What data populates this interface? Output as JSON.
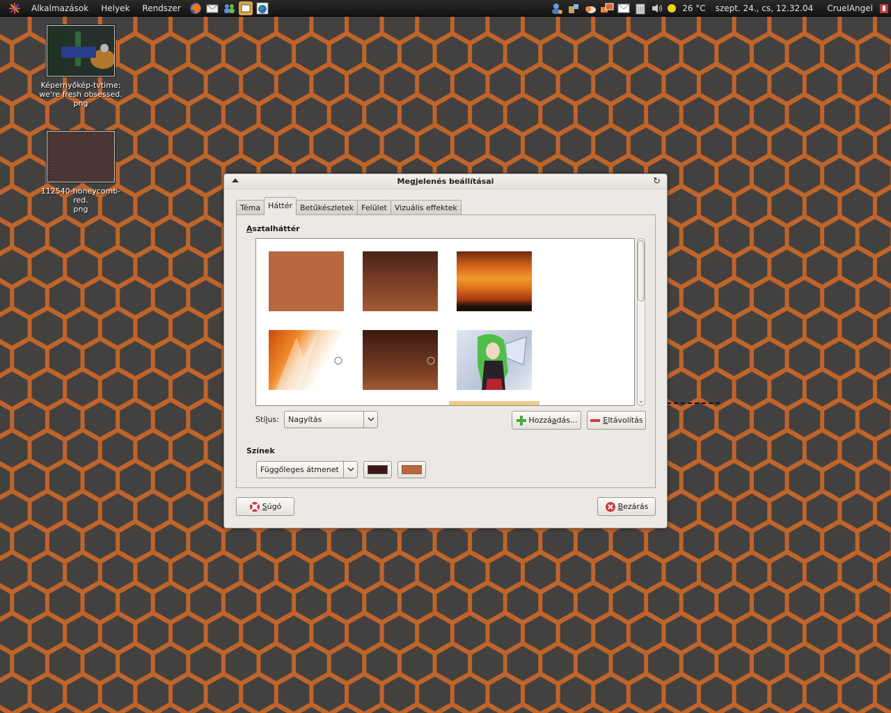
{
  "panel": {
    "menus": [
      "Alkalmazások",
      "Helyek",
      "Rendszer"
    ],
    "launchers": [
      "firefox-icon",
      "mail-icon",
      "contacts-icon",
      "show-desktop-icon",
      "network-globe-icon"
    ],
    "tray_icons": [
      "user-icon",
      "network-icon",
      "update-icon",
      "display-icon",
      "mail-notify-icon",
      "trash-icon",
      "volume-icon"
    ],
    "temperature": "26 °C",
    "clock": "szept. 24., cs, 12.32.04",
    "user": "CruelAngel"
  },
  "desktop_icons": [
    {
      "label_line1": "Képernyőkép-tvtime:",
      "label_line2": "we're fresh obsessed.",
      "label_line3": "png"
    },
    {
      "label_line1": "112540-honeycomb-red.",
      "label_line2": "png"
    }
  ],
  "dialog": {
    "title": "Megjelenés beállításai",
    "tabs": [
      "Téma",
      "Háttér",
      "Betűkészletek",
      "Felület",
      "Vizuális effektek"
    ],
    "active_tab": "Háttér",
    "background_section": {
      "label_mnemonic": "A",
      "label_rest": "sztalháttér"
    },
    "wallpapers": [
      "solid-orange",
      "brown-texture",
      "sunset-clouds",
      "orange-abstract",
      "dark-brown-gradient",
      "anime-green-hair"
    ],
    "style": {
      "label_pre": "Stí",
      "label_mn": "l",
      "label_post": "us:",
      "value": "Nagyítás"
    },
    "add_button": {
      "pre": "Hozzá",
      "mn": "a",
      "post": "dás..."
    },
    "remove_button": {
      "mn": "E",
      "post": "ltávolítás"
    },
    "colors_section": "Színek",
    "color_mode": "Függőleges átmenet",
    "colors": [
      "#3e1613",
      "#b7683e"
    ],
    "help_button": {
      "mn": "S",
      "post": "úgó"
    },
    "close_button": {
      "mn": "B",
      "post": "ezárás"
    }
  },
  "theme": {
    "accent": "#b8662f",
    "desktop_hex": "#3d3a39"
  }
}
